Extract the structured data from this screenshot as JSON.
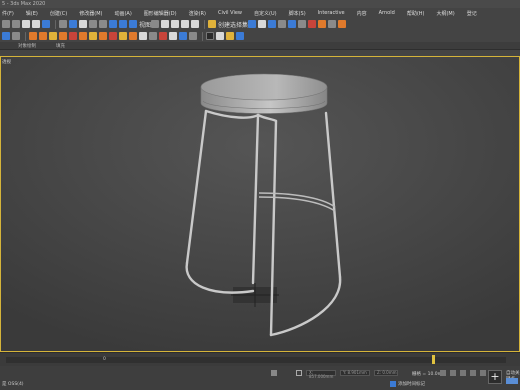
{
  "window": {
    "title": "5 - 3ds Max 2020"
  },
  "menu": {
    "items": [
      "件(F)",
      "辑(E)",
      "创建(C)",
      "修改器(M)",
      "动画(A)",
      "图形编辑器(D)",
      "渲染(R)",
      "Civil View",
      "自定义(U)",
      "脚本(S)",
      "Interactive",
      "内容",
      "Arnold",
      "帮助(H)",
      "大纲(M)",
      "登记"
    ],
    "selection_set_label": "创建选择集"
  },
  "toolbar": {
    "view_dropdown": "视图",
    "icons": [
      "undo-icon",
      "redo-icon",
      "select-link-icon",
      "unlink-icon",
      "bind-spacewarp-icon",
      "selection-filter-dropdown",
      "select-icon",
      "select-by-name-icon",
      "rect-selection-icon",
      "window-crossing-icon",
      "move-icon",
      "rotate-icon",
      "scale-icon",
      "reference-coord-dropdown",
      "pivot-icon",
      "snap-3-icon",
      "angle-snap-icon",
      "percent-snap-icon",
      "spinner-snap-icon",
      "mirror-icon",
      "align-icon",
      "layer-icon",
      "curve-editor-icon",
      "schematic-icon",
      "material-editor-icon",
      "render-setup-icon",
      "render-frame-icon",
      "render-icon"
    ]
  },
  "ribbon": {
    "left_label": "对象绘制",
    "mid_label": "填充"
  },
  "viewport": {
    "label": "透视"
  },
  "timeline": {
    "current_frame": "0"
  },
  "status": {
    "text": "是 OSS(4)",
    "coords": {
      "x": "X: 857.000mm",
      "y": "Y: 8.901mm",
      "z": "Z: 0.0mm"
    },
    "grid": "栅格 = 10.0mm",
    "add_key_label": "添加时间标记",
    "auto_key_label": "自动关键点"
  },
  "colors": {
    "accent": "#3b7bd6",
    "viewport_border": "#d5b43a",
    "timeline_knob": "#e0c240"
  }
}
